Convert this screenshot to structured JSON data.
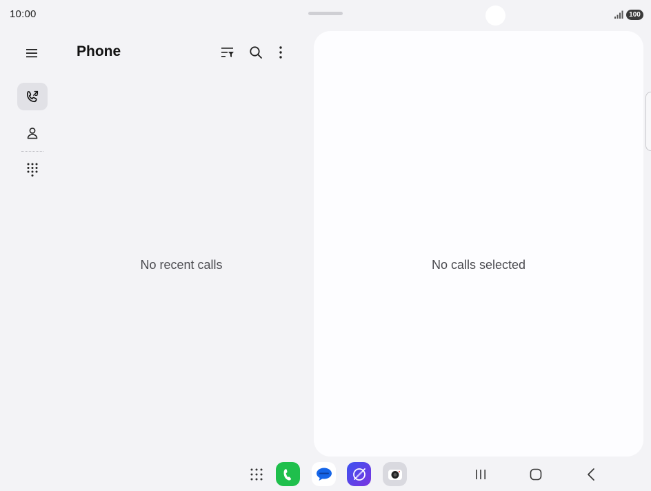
{
  "status_bar": {
    "time": "10:00",
    "battery": "100",
    "signal_icon": "signal-icon"
  },
  "rail": {
    "menu_icon": "menu-icon",
    "items": [
      {
        "icon": "recents-call-icon",
        "active": true
      },
      {
        "icon": "contacts-icon",
        "active": false
      },
      {
        "icon": "keypad-icon",
        "active": false
      }
    ]
  },
  "header": {
    "title": "Phone",
    "actions": [
      "filter-icon",
      "search-icon",
      "more-options-icon"
    ]
  },
  "calls_list": {
    "empty_message": "No recent calls"
  },
  "detail": {
    "empty_message": "No calls selected"
  },
  "taskbar": {
    "apps": [
      "app-drawer-icon",
      "phone-app-icon",
      "messages-app-icon",
      "internet-app-icon",
      "camera-app-icon"
    ],
    "nav": [
      "recents-nav-icon",
      "home-nav-icon",
      "back-nav-icon"
    ]
  },
  "colors": {
    "background": "#f3f3f6",
    "panel": "#fdfdff",
    "phone_green": "#1fbf4c",
    "messages_blue": "#1565e8",
    "internet_purple": "#5c3fe6"
  }
}
